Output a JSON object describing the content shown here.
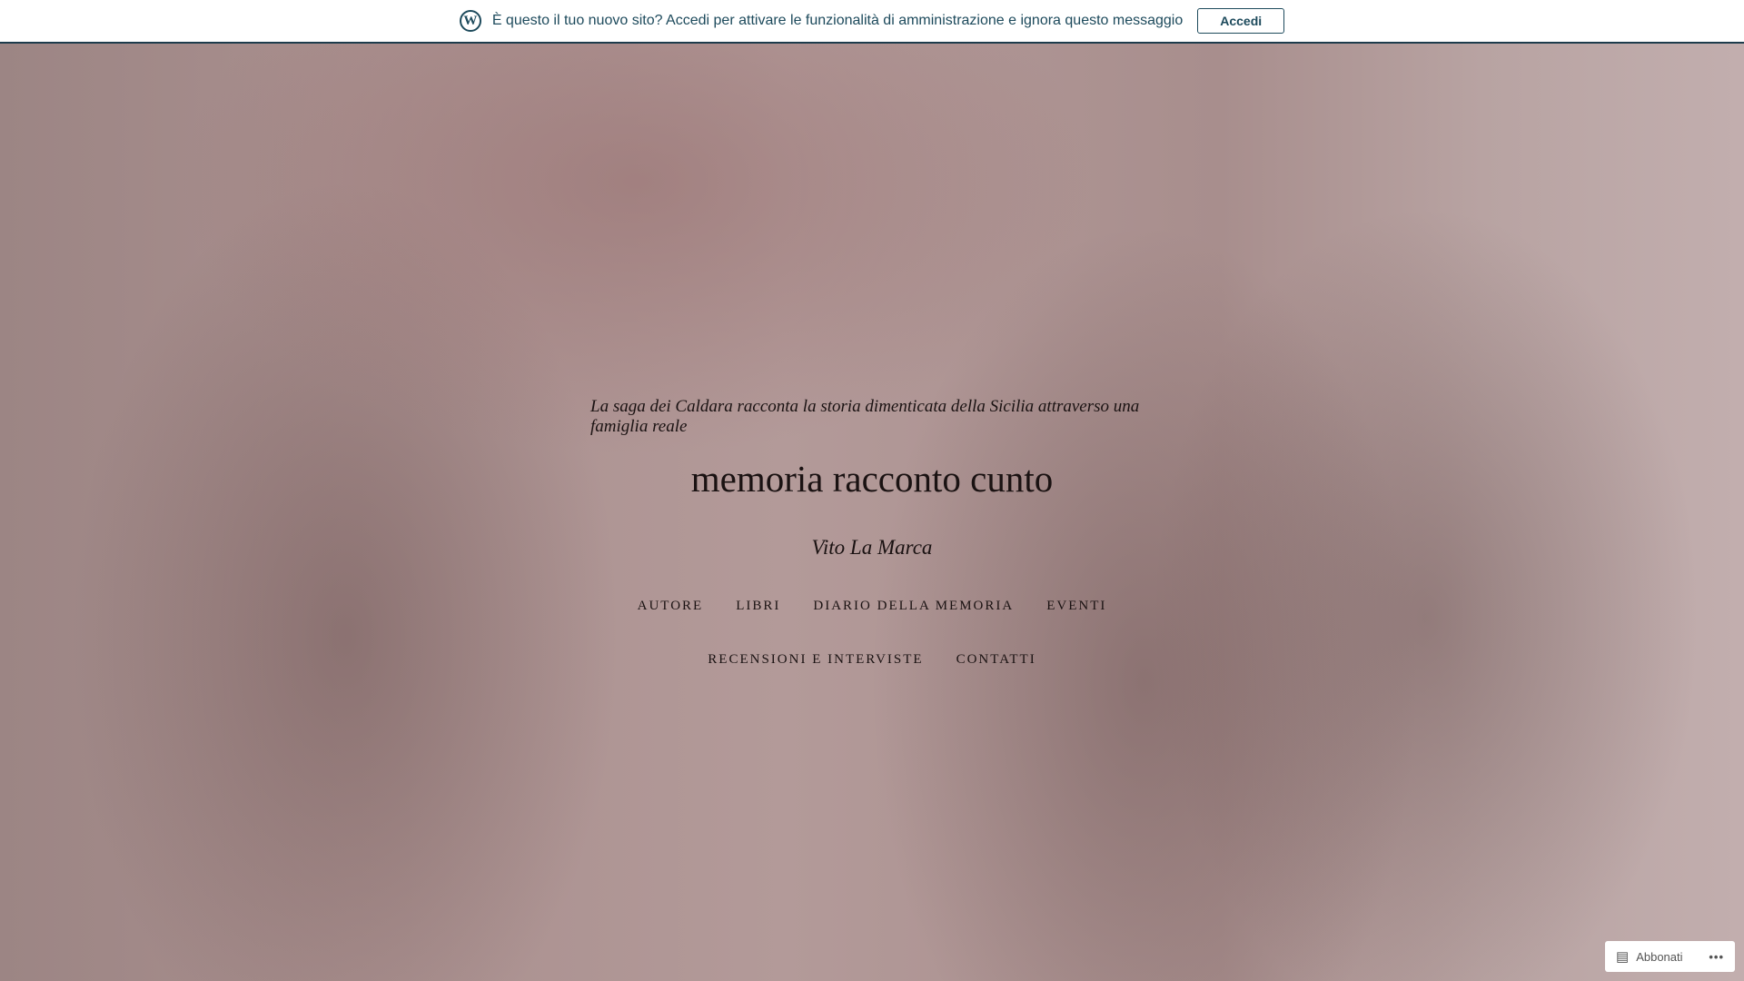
{
  "topbar": {
    "message": "È questo il tuo nuovo sito? Accedi per attivare le funzionalità di amministrazione e ignora questo messaggio",
    "button": "Accedi"
  },
  "header": {
    "tagline": "La saga dei Caldara racconta la storia dimenticata della Sicilia attraverso una famiglia reale",
    "title": "memoria racconto cunto",
    "author": "Vito La Marca"
  },
  "nav": {
    "row1": [
      "AUTORE",
      "LIBRI",
      "DIARIO DELLA MEMORIA",
      "EVENTI"
    ],
    "row2": [
      "RECENSIONI E INTERVISTE",
      "CONTATTI"
    ]
  },
  "subscribe": {
    "label": "Abbonati",
    "more": "•••"
  }
}
